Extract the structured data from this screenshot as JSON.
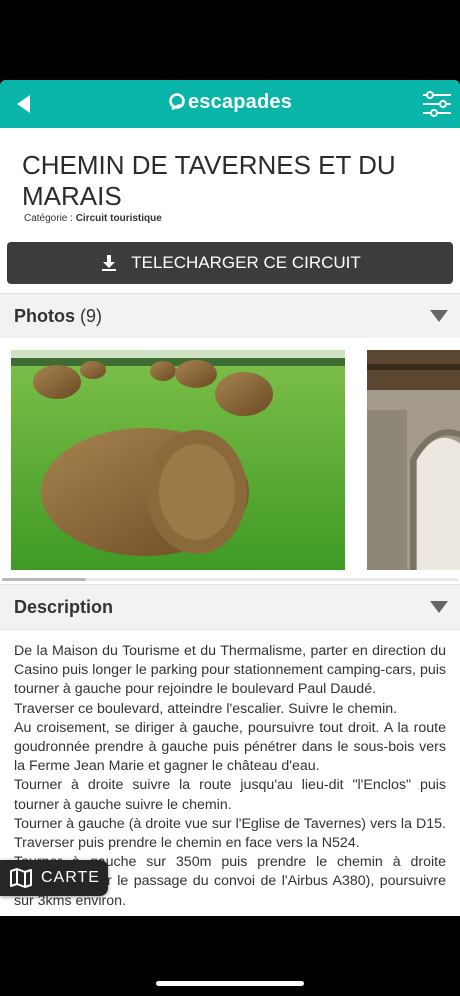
{
  "header": {
    "logo_text": "escapades",
    "back_icon": "back-arrow-icon",
    "filter_icon": "sliders-icon",
    "accent_color": "#09b5a8"
  },
  "circuit": {
    "title": "CHEMIN DE TAVERNES ET DU MARAIS",
    "category_label": "Catégorie :",
    "category_value": "Circuit touristique"
  },
  "download": {
    "label": "TELECHARGER CE CIRCUIT",
    "icon": "download-icon"
  },
  "photos": {
    "label": "Photos",
    "count": "(9)"
  },
  "description": {
    "label": "Description",
    "paragraphs": [
      "De la Maison du Tourisme et du Thermalisme, parter en direction du Casino puis longer le parking pour stationnement camping-cars, puis tourner à gauche pour rejoindre le boulevard Paul Daudé.",
      "Traverser ce boulevard, atteindre l'escalier. Suivre le chemin.",
      "Au croisement, se diriger à gauche, poursuivre tout droit. A la route goudronnée prendre à gauche puis pénétrer dans le sous-bois vers la Ferme Jean Marie et gagner le château d'eau.",
      "Tourner à droite suivre la route jusqu'au lieu-dit \"l'Enclos\" puis tourner à gauche suivre le chemin.",
      "Tourner à gauche (à droite vue sur l'Eglise de Tavernes) vers la D15. Traverser puis prendre le chemin en face vers la N524.",
      "Tourner à gauche sur 350m puis prendre le chemin à droite (aménagé pour le passage du convoi de l'Airbus A380), poursuivre sur 3kms environ."
    ]
  },
  "map_button": {
    "label": "CARTE",
    "icon": "map-icon"
  }
}
